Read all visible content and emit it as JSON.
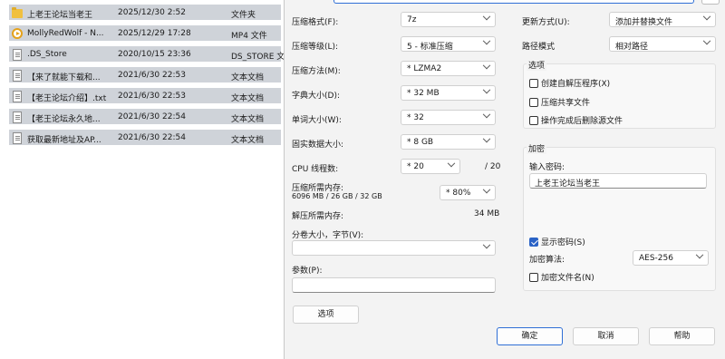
{
  "files": [
    {
      "name": "上老王论坛当老王",
      "date": "2025/12/30 2:52",
      "type": "文件夹",
      "icon": "folder-icon"
    },
    {
      "name": "MollyRedWolf - N...",
      "date": "2025/12/29 17:28",
      "type": "MP4 文件",
      "icon": "video-file-icon"
    },
    {
      "name": ".DS_Store",
      "date": "2020/10/15 23:36",
      "type": "DS_STORE 文件",
      "icon": "file-icon"
    },
    {
      "name": "【来了就能下载和...",
      "date": "2021/6/30 22:53",
      "type": "文本文档",
      "icon": "text-file-icon"
    },
    {
      "name": "【老王论坛介绍】.txt",
      "date": "2021/6/30 22:53",
      "type": "文本文档",
      "icon": "text-file-icon"
    },
    {
      "name": "【老王论坛永久地...",
      "date": "2021/6/30 22:54",
      "type": "文本文档",
      "icon": "text-file-icon"
    },
    {
      "name": "获取最新地址及AP...",
      "date": "2021/6/30 22:54",
      "type": "文本文档",
      "icon": "text-file-icon"
    }
  ],
  "left": {
    "format_label": "压缩格式(F):",
    "format_value": "7z",
    "level_label": "压缩等级(L):",
    "level_value": "5 - 标准压缩",
    "method_label": "压缩方法(M):",
    "method_value": "* LZMA2",
    "dict_label": "字典大小(D):",
    "dict_value": "* 32 MB",
    "word_label": "单词大小(W):",
    "word_value": "* 32",
    "solid_label": "固实数据大小:",
    "solid_value": "* 8 GB",
    "threads_label": "CPU 线程数:",
    "threads_value": "* 20",
    "threads_total": "/ 20",
    "mem_label": "压缩所需内存:",
    "mem_detail": "6096 MB / 26 GB / 32 GB",
    "mem_percent": "* 80%",
    "decomp_label": "解压所需内存:",
    "decomp_value": "34 MB",
    "split_label": "分卷大小，字节(V):",
    "split_value": "",
    "params_label": "参数(P):",
    "params_value": "",
    "options_button": "选项"
  },
  "right": {
    "update_label": "更新方式(U):",
    "update_value": "添加并替换文件",
    "path_label": "路径模式",
    "path_value": "相对路径",
    "options_title": "选项",
    "opt_sfx": "创建自解压程序(X)",
    "opt_shared": "压缩共享文件",
    "opt_delete": "操作完成后删除源文件",
    "encrypt_title": "加密",
    "password_label": "输入密码:",
    "password_value": "上老王论坛当老王",
    "show_password": "显示密码(S)",
    "algo_label": "加密算法:",
    "algo_value": "AES-256",
    "encrypt_names": "加密文件名(N)"
  },
  "buttons": {
    "ok": "确定",
    "cancel": "取消",
    "help": "帮助"
  },
  "colors": {
    "accent": "#2b63c6",
    "selection": "#cfd3d9",
    "folder": "#f0c040"
  }
}
